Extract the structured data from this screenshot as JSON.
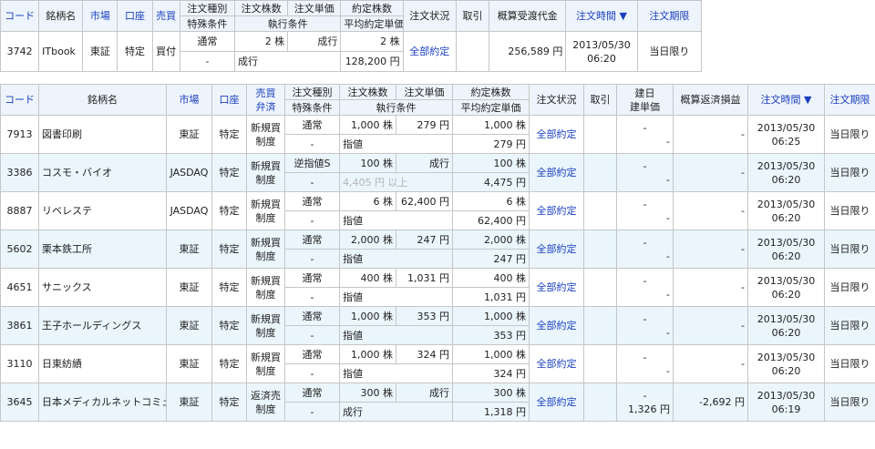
{
  "colors": {
    "header_bg": "#eef4fb",
    "alt_row_bg": "#eaf6fc",
    "link": "#1a3fbf",
    "border": "#c6c6c6"
  },
  "top": {
    "headers": {
      "code": "コード",
      "name": "銘柄名",
      "market": "市場",
      "account": "口座",
      "side": "売買",
      "order_type": "注文種別",
      "special": "特殊条件",
      "qty": "注文株数",
      "exec_cond": "執行条件",
      "price": "注文単価",
      "filled": "約定株数",
      "avg_price": "平均約定単価",
      "status": "注文状況",
      "cancel": "取引",
      "amount": "概算受渡代金",
      "time": "注文時間",
      "sort_icon": "▼",
      "limit": "注文期限"
    },
    "row": {
      "code": "3742",
      "name": "ITbook",
      "market": "東証",
      "account": "特定",
      "side": "買付",
      "order_type": "通常",
      "special": "-",
      "qty": "2 株",
      "exec_cond": "成行",
      "price": "成行",
      "filled": "2 株",
      "avg_price": "128,200 円",
      "status": "全部約定",
      "amount": "256,589 円",
      "date": "2013/05/30",
      "time": "06:20",
      "limit": "当日限り"
    }
  },
  "bottom": {
    "headers": {
      "code": "コード",
      "name": "銘柄名",
      "market": "市場",
      "account": "口座",
      "side_a": "売買",
      "side_b": "弁済",
      "order_type": "注文種別",
      "special": "特殊条件",
      "qty": "注文株数",
      "exec_cond": "執行条件",
      "price": "注文単価",
      "filled": "約定株数",
      "avg_price": "平均約定単価",
      "status": "注文状況",
      "cancel": "取引",
      "build_a": "建日",
      "build_b": "建単価",
      "pnl": "概算返済損益",
      "time": "注文時間",
      "sort_icon": "▼",
      "limit": "注文期限"
    },
    "rows": [
      {
        "code": "7913",
        "name": "図書印刷",
        "market": "東証",
        "account": "特定",
        "side_a": "新規買",
        "side_b": "制度",
        "order_type": "通常",
        "special": "-",
        "qty": "1,000 株",
        "price": "279 円",
        "exec_cond": "指値",
        "filled": "1,000 株",
        "avg_price": "279 円",
        "status": "全部約定",
        "build_a": "-",
        "build_b": "-",
        "pnl": "-",
        "date": "2013/05/30",
        "time": "06:25",
        "limit": "当日限り"
      },
      {
        "code": "3386",
        "name": "コスモ・バイオ",
        "market": "JASDAQ",
        "account": "特定",
        "side_a": "新規買",
        "side_b": "制度",
        "order_type": "逆指値S",
        "special": "-",
        "qty": "100 株",
        "price": "成行",
        "exec_cond": "4,405 円 以上",
        "filled": "100 株",
        "avg_price": "4,475 円",
        "status": "全部約定",
        "build_a": "-",
        "build_b": "-",
        "pnl": "-",
        "date": "2013/05/30",
        "time": "06:20",
        "limit": "当日限り"
      },
      {
        "code": "8887",
        "name": "リベレステ",
        "market": "JASDAQ",
        "account": "特定",
        "side_a": "新規買",
        "side_b": "制度",
        "order_type": "通常",
        "special": "-",
        "qty": "6 株",
        "price": "62,400 円",
        "exec_cond": "指値",
        "filled": "6 株",
        "avg_price": "62,400 円",
        "status": "全部約定",
        "build_a": "-",
        "build_b": "-",
        "pnl": "-",
        "date": "2013/05/30",
        "time": "06:20",
        "limit": "当日限り"
      },
      {
        "code": "5602",
        "name": "栗本鉄工所",
        "market": "東証",
        "account": "特定",
        "side_a": "新規買",
        "side_b": "制度",
        "order_type": "通常",
        "special": "-",
        "qty": "2,000 株",
        "price": "247 円",
        "exec_cond": "指値",
        "filled": "2,000 株",
        "avg_price": "247 円",
        "status": "全部約定",
        "build_a": "-",
        "build_b": "-",
        "pnl": "-",
        "date": "2013/05/30",
        "time": "06:20",
        "limit": "当日限り"
      },
      {
        "code": "4651",
        "name": "サニックス",
        "market": "東証",
        "account": "特定",
        "side_a": "新規買",
        "side_b": "制度",
        "order_type": "通常",
        "special": "-",
        "qty": "400 株",
        "price": "1,031 円",
        "exec_cond": "指値",
        "filled": "400 株",
        "avg_price": "1,031 円",
        "status": "全部約定",
        "build_a": "-",
        "build_b": "-",
        "pnl": "-",
        "date": "2013/05/30",
        "time": "06:20",
        "limit": "当日限り"
      },
      {
        "code": "3861",
        "name": "王子ホールディングス",
        "market": "東証",
        "account": "特定",
        "side_a": "新規買",
        "side_b": "制度",
        "order_type": "通常",
        "special": "-",
        "qty": "1,000 株",
        "price": "353 円",
        "exec_cond": "指値",
        "filled": "1,000 株",
        "avg_price": "353 円",
        "status": "全部約定",
        "build_a": "-",
        "build_b": "-",
        "pnl": "-",
        "date": "2013/05/30",
        "time": "06:20",
        "limit": "当日限り"
      },
      {
        "code": "3110",
        "name": "日東紡績",
        "market": "東証",
        "account": "特定",
        "side_a": "新規買",
        "side_b": "制度",
        "order_type": "通常",
        "special": "-",
        "qty": "1,000 株",
        "price": "324 円",
        "exec_cond": "指値",
        "filled": "1,000 株",
        "avg_price": "324 円",
        "status": "全部約定",
        "build_a": "-",
        "build_b": "-",
        "pnl": "-",
        "date": "2013/05/30",
        "time": "06:20",
        "limit": "当日限り"
      },
      {
        "code": "3645",
        "name": "日本メディカルネットコミュ",
        "market": "東証",
        "account": "特定",
        "side_a": "返済売",
        "side_b": "制度",
        "order_type": "通常",
        "special": "-",
        "qty": "300 株",
        "price": "成行",
        "exec_cond": "成行",
        "filled": "300 株",
        "avg_price": "1,318 円",
        "status": "全部約定",
        "build_a": "-",
        "build_b": "1,326 円",
        "pnl": "-2,692 円",
        "date": "2013/05/30",
        "time": "06:19",
        "limit": "当日限り"
      }
    ]
  }
}
